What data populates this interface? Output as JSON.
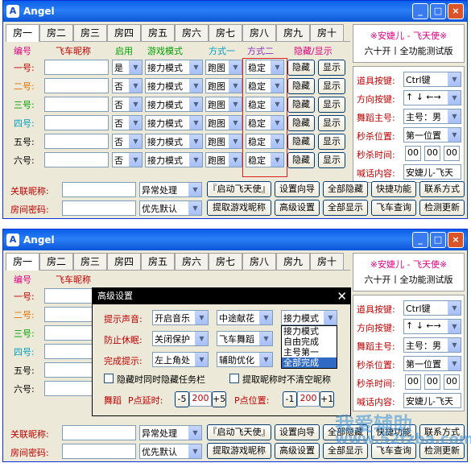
{
  "app": {
    "title": "Angel",
    "colors": {
      "titlebar": "#0a5fe8",
      "pink": "#e0007f",
      "red": "#c00000",
      "green": "#00a000",
      "cyan": "#00a0c0",
      "purple": "#9030c0",
      "blue": "#2a40c0",
      "orange": "#e07000"
    }
  },
  "tabs": [
    "房一",
    "房二",
    "房三",
    "房四",
    "房五",
    "房六",
    "房七",
    "房八",
    "房九",
    "房十"
  ],
  "header": {
    "id": "编号",
    "nick": "飞车昵称",
    "enable": "启用",
    "mode": "游戏模式",
    "m1": "方式一",
    "m2": "方式二",
    "hs": "隐藏/显示"
  },
  "rows": [
    {
      "label": "一号:",
      "enable": "是",
      "mode": "接力模式",
      "m1": "跑图",
      "m2": "稳定",
      "hide": "隐藏",
      "show": "显示"
    },
    {
      "label": "二号:",
      "enable": "否",
      "mode": "接力模式",
      "m1": "跑图",
      "m2": "稳定",
      "hide": "隐藏",
      "show": "显示"
    },
    {
      "label": "三号:",
      "enable": "否",
      "mode": "接力模式",
      "m1": "跑图",
      "m2": "稳定",
      "hide": "隐藏",
      "show": "显示"
    },
    {
      "label": "四号:",
      "enable": "否",
      "mode": "接力模式",
      "m1": "跑图",
      "m2": "稳定",
      "hide": "隐藏",
      "show": "显示"
    },
    {
      "label": "五号:",
      "enable": "否",
      "mode": "接力模式",
      "m1": "跑图",
      "m2": "稳定",
      "hide": "隐藏",
      "show": "显示"
    },
    {
      "label": "六号:",
      "enable": "否",
      "mode": "接力模式",
      "m1": "跑图",
      "m2": "稳定",
      "hide": "隐藏",
      "show": "显示"
    }
  ],
  "bottom": {
    "assoc": "关联昵称:",
    "pwd": "房间密码:",
    "sel1": "异常处理",
    "sel2": "优先默认",
    "b1": "『启动飞天使』",
    "b2": "设置向导",
    "b3": "全部隐藏",
    "b4": "快捷功能",
    "b5": "联系方式",
    "b6": "提取游戏昵称",
    "b7": "高级设置",
    "b8": "全部显示",
    "b9": "飞车查询",
    "b10": "检测更新"
  },
  "right": {
    "t1": "※安婕儿 - 飞天使※",
    "t2": "六十开丨全功能测试版",
    "items": [
      {
        "label": "道具按键:",
        "value": "Ctrl键"
      },
      {
        "label": "方向按键:",
        "value": "↑ ↓ ←→"
      },
      {
        "label": "舞蹈主号:",
        "value": "主号：男"
      },
      {
        "label": "秒杀位置:",
        "value": "第一位置"
      },
      {
        "label": "秒杀时间:",
        "h": "00",
        "m": "00",
        "s": "00"
      },
      {
        "label": "喊话内容:",
        "value": "安婕儿-飞天"
      }
    ]
  },
  "dialog": {
    "title": "高级设置",
    "sound_label": "提示声音:",
    "sound": "开启音乐",
    "sound2": "中途献花",
    "mode": "接力模式",
    "sleep_label": "防止休眠:",
    "sleep": "关闭保护",
    "dance": "飞车舞蹈",
    "done_label": "完成提示:",
    "done": "左上角处",
    "assist": "辅助优化",
    "cb1": "隐藏时同时隐藏任务栏",
    "cb2": "提取昵称时不清空昵称",
    "dance_label": "舞蹈",
    "p_delay": "P点延时:",
    "minus": "-5",
    "val1": "200",
    "plus": "+5",
    "p_pos": "P点位置:",
    "minus2": "-1",
    "val2": "200",
    "plus2": "+1",
    "options": [
      "接力模式",
      "自由完成",
      "主号第一",
      "全部完成"
    ]
  },
  "watermark": {
    "text1": "我爱辅助",
    "text2": "www.52fzba.com"
  }
}
